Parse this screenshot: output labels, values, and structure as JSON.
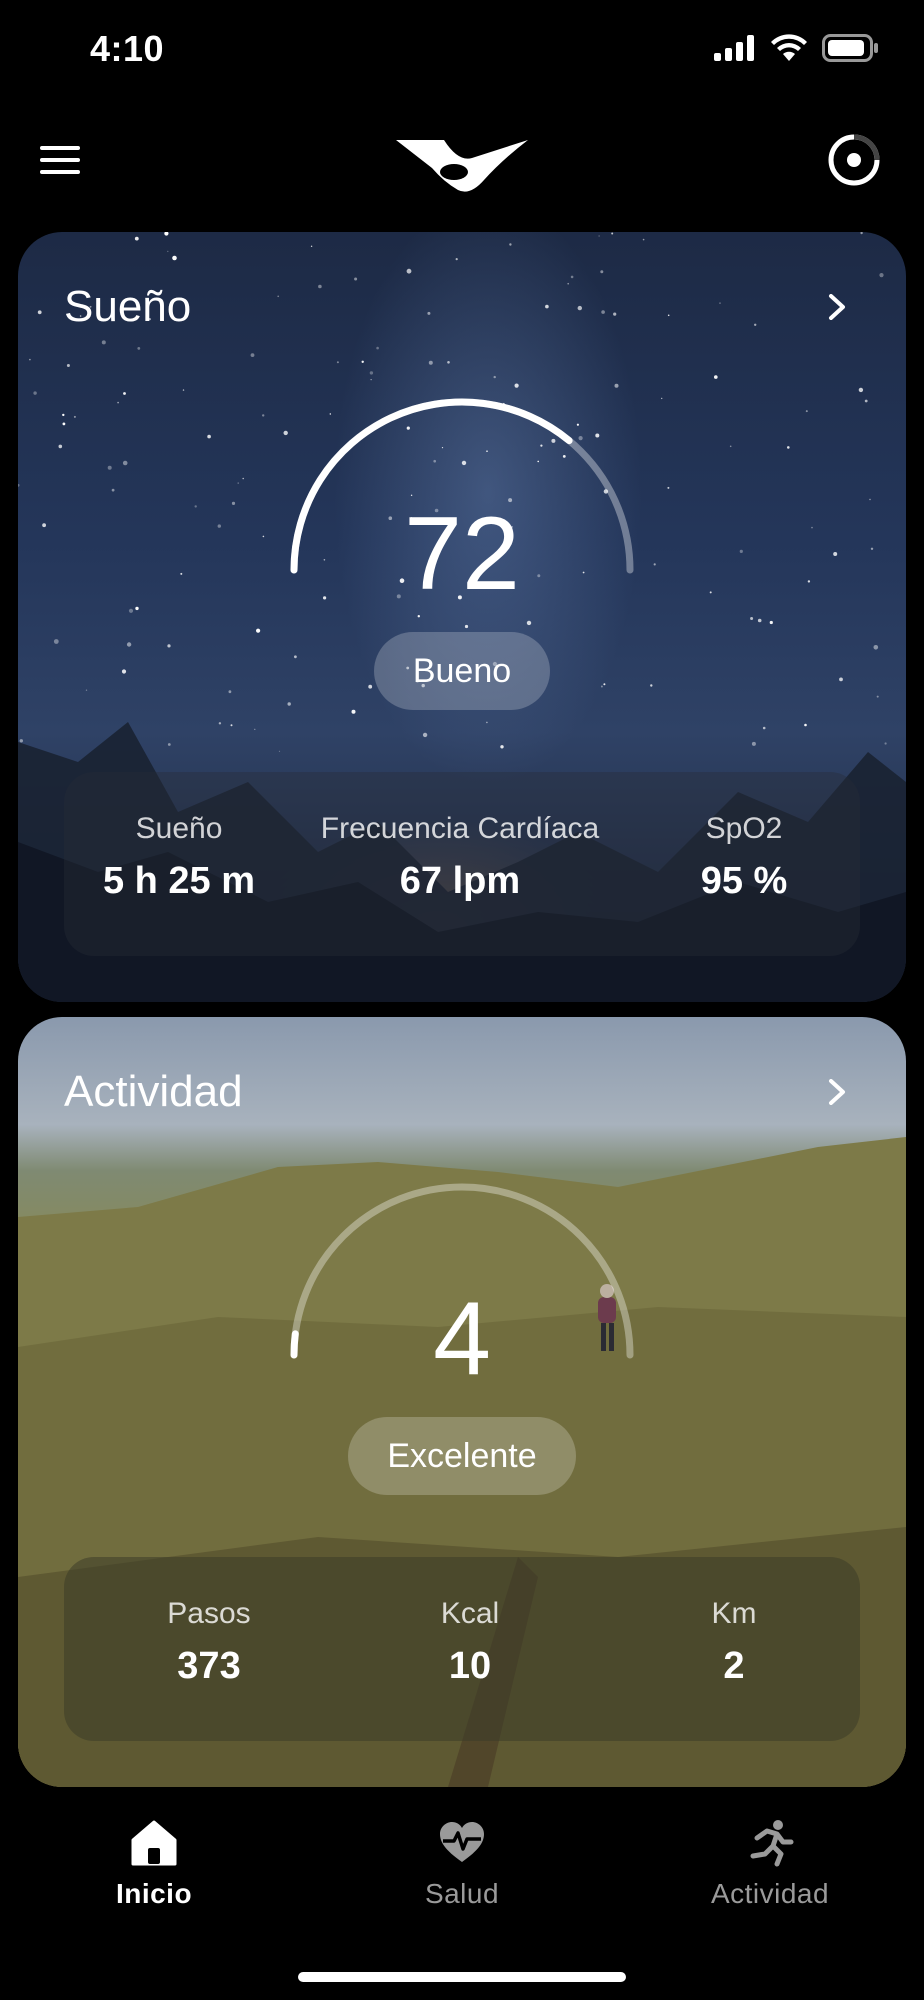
{
  "status_bar": {
    "time": "4:10"
  },
  "top_bar": {
    "menu_icon": "hamburger-menu-icon",
    "logo": "brand-logo",
    "sync_icon": "sync-ring-icon"
  },
  "sleep_card": {
    "title": "Sueño",
    "score": "72",
    "score_fraction": 0.72,
    "rating": "Bueno",
    "stats": [
      {
        "label": "Sueño",
        "value": "5 h 25 m"
      },
      {
        "label": "Frecuencia Cardíaca",
        "value": "67 lpm"
      },
      {
        "label": "SpO2",
        "value": "95 %"
      }
    ]
  },
  "activity_card": {
    "title": "Actividad",
    "score": "4",
    "score_fraction": 0.04,
    "rating": "Excelente",
    "stats": [
      {
        "label": "Pasos",
        "value": "373"
      },
      {
        "label": "Kcal",
        "value": "10"
      },
      {
        "label": "Km",
        "value": "2"
      }
    ]
  },
  "bottom_nav": [
    {
      "label": "Inicio",
      "icon": "home-icon",
      "active": true
    },
    {
      "label": "Salud",
      "icon": "heart-pulse-icon",
      "active": false
    },
    {
      "label": "Actividad",
      "icon": "running-person-icon",
      "active": false
    }
  ],
  "colors": {
    "background": "#000000",
    "text": "#ffffff",
    "inactive": "#9a9a9a"
  }
}
